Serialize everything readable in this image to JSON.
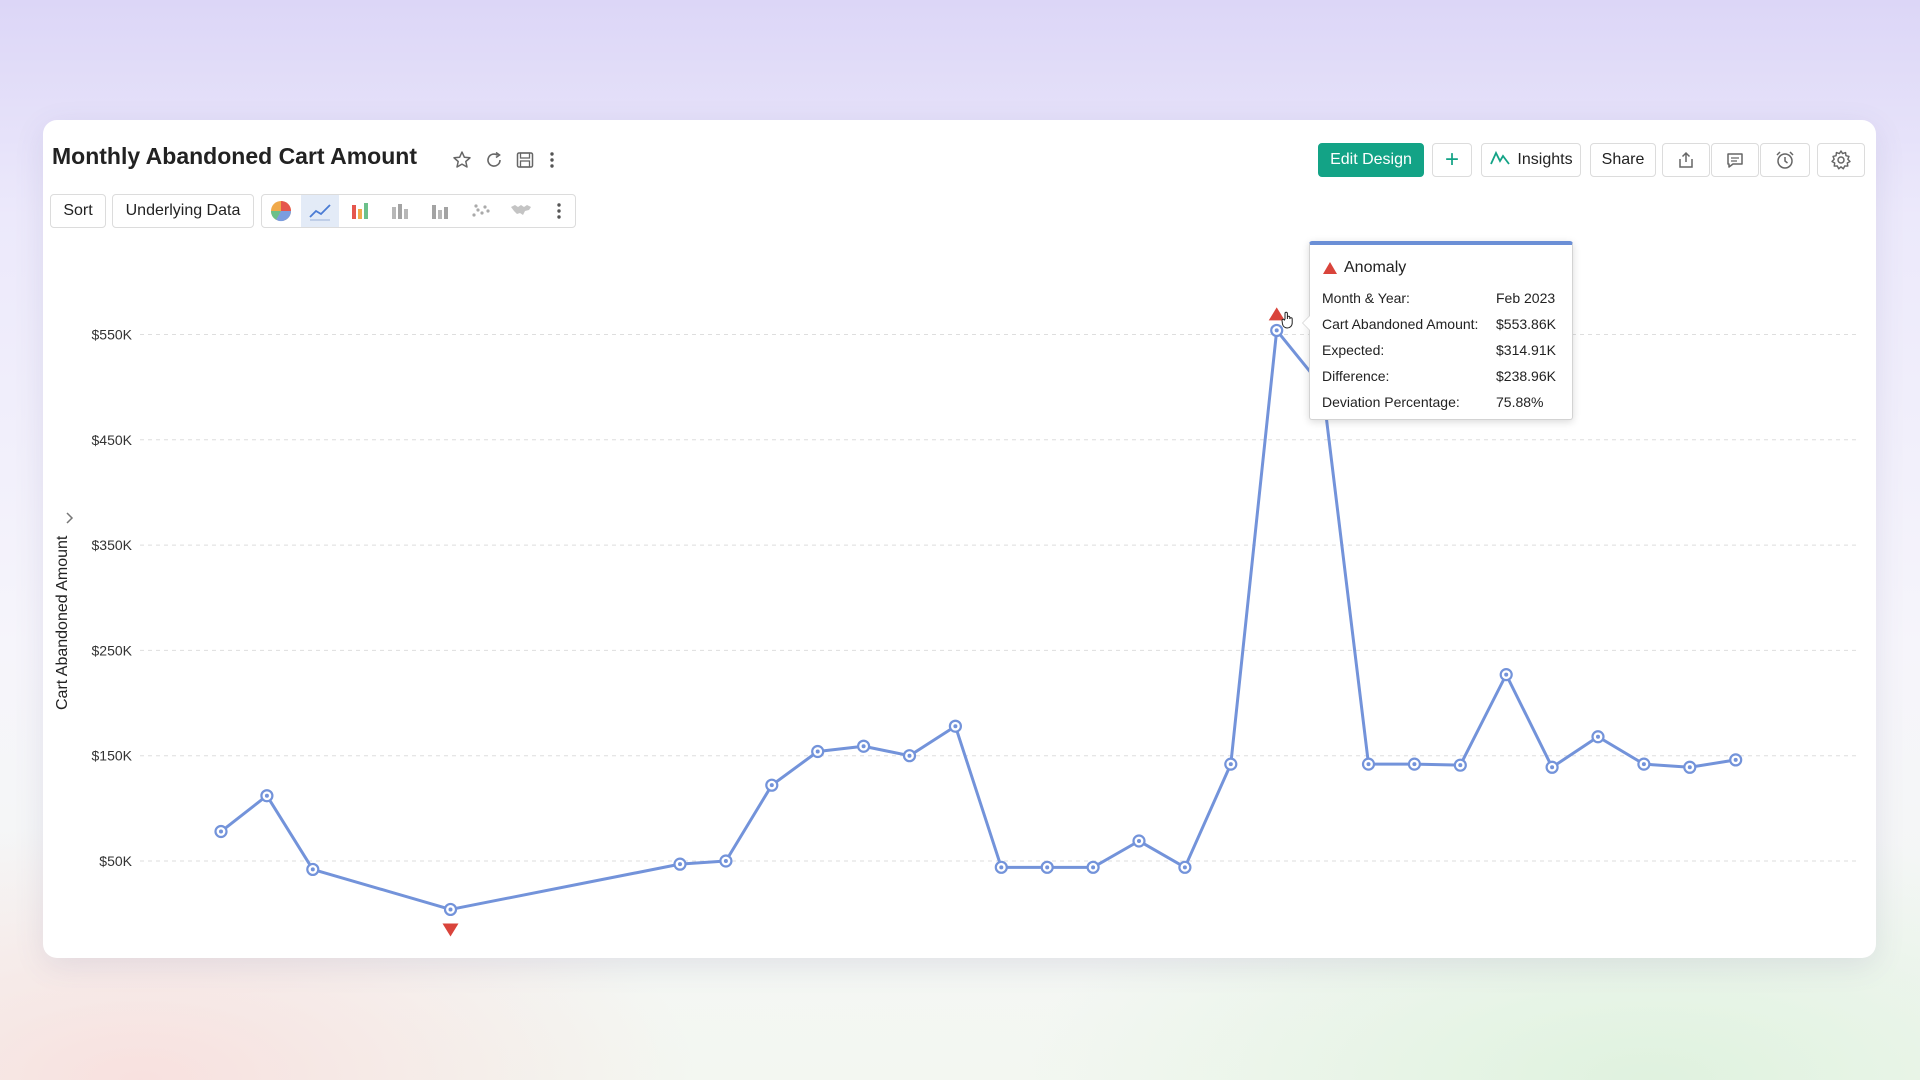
{
  "header": {
    "title": "Monthly Abandoned Cart Amount",
    "edit_design_label": "Edit Design",
    "add_label": "+",
    "insights_label": "Insights",
    "share_label": "Share"
  },
  "toolbar": {
    "sort_label": "Sort",
    "underlying_data_label": "Underlying Data",
    "chart_type_icons": [
      "pie-chart-icon",
      "line-chart-icon",
      "bar-chart-icon",
      "stacked-bar-icon",
      "grouped-bar-icon",
      "scatter-icon",
      "map-icon"
    ]
  },
  "colors": {
    "accent": "#13a386",
    "series": "#7393da",
    "anomaly": "#d9443b",
    "tooltip_border": "#6b8fd6"
  },
  "tooltip": {
    "heading": "Anomaly",
    "rows": [
      {
        "label": "Month & Year:",
        "value": "Feb 2023"
      },
      {
        "label": "Cart Abandoned Amount:",
        "value": "$553.86K"
      },
      {
        "label": "Expected:",
        "value": "$314.91K"
      },
      {
        "label": "Difference:",
        "value": "$238.96K"
      },
      {
        "label": "Deviation Percentage:",
        "value": "75.88%"
      }
    ]
  },
  "chart_data": {
    "type": "line",
    "title": "",
    "xlabel": "",
    "ylabel": "Cart Abandoned Amount",
    "ylim": [
      10,
      590
    ],
    "yticks": [
      50,
      150,
      250,
      350,
      450,
      550
    ],
    "ytick_labels": [
      "$50K",
      "$150K",
      "$250K",
      "$350K",
      "$450K",
      "$550K"
    ],
    "grid": true,
    "series": [
      {
        "x": [
          0,
          1,
          2,
          5,
          10,
          11,
          12,
          13,
          14,
          15,
          16,
          17,
          18,
          19,
          20,
          21,
          22,
          23,
          24,
          25,
          26,
          27,
          28,
          29,
          30,
          31,
          32,
          33,
          34,
          35
        ],
        "values": [
          78,
          112,
          42,
          4,
          47,
          50,
          122,
          154,
          159,
          150,
          178,
          44,
          44,
          44,
          69,
          44,
          142,
          553.86,
          500,
          142,
          142,
          141,
          227,
          139,
          168,
          142,
          139,
          146,
          null,
          null
        ]
      }
    ],
    "anomalies": [
      {
        "x": 5,
        "direction": "down"
      },
      {
        "x": 23,
        "direction": "up"
      }
    ]
  }
}
